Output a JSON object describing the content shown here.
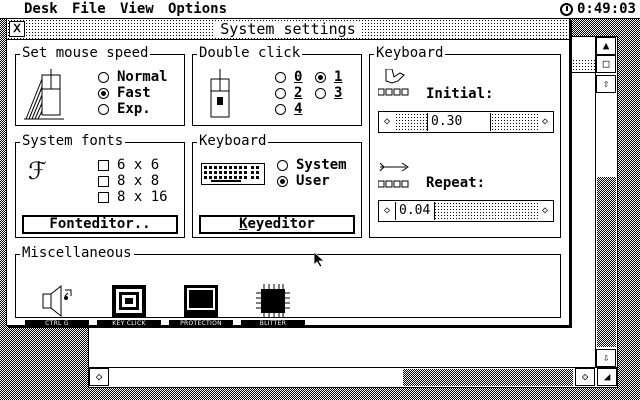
{
  "menubar": {
    "items": [
      "Desk",
      "File",
      "View",
      "Options"
    ],
    "clock": "0:49:03"
  },
  "dialog": {
    "title": "System settings",
    "mouse_speed": {
      "title": "Set mouse speed",
      "options": [
        {
          "label": "Normal",
          "selected": false
        },
        {
          "label": "Fast",
          "selected": true
        },
        {
          "label": "Exp.",
          "selected": false
        }
      ]
    },
    "double_click": {
      "title": "Double click",
      "options": [
        {
          "label": "0",
          "selected": false
        },
        {
          "label": "1",
          "selected": true
        },
        {
          "label": "2",
          "selected": false
        },
        {
          "label": "3",
          "selected": false
        },
        {
          "label": "4",
          "selected": false
        }
      ]
    },
    "system_fonts": {
      "title": "System fonts",
      "options": [
        "6 x 6",
        "8 x 8",
        "8 x 16"
      ],
      "button": "Fonteditor.."
    },
    "keyboard_layout": {
      "title": "Keyboard",
      "options": [
        {
          "label": "System",
          "selected": false
        },
        {
          "label": "User",
          "selected": true
        }
      ],
      "button_prefix": "K",
      "button_rest": "eyeditor"
    },
    "keyboard_repeat": {
      "title": "Keyboard",
      "initial_label": "Initial:",
      "initial_value": "0.30",
      "repeat_label": "Repeat:",
      "repeat_value": "0.04"
    },
    "misc": {
      "title": "Miscellaneous",
      "icons": [
        {
          "label": "CTRL G",
          "icon": "speaker-icon"
        },
        {
          "label": "KEY CLICK",
          "icon": "key-click-icon"
        },
        {
          "label": "PROTECTION",
          "icon": "monitor-icon"
        },
        {
          "label": "BLITTER",
          "icon": "chip-icon"
        }
      ]
    }
  }
}
